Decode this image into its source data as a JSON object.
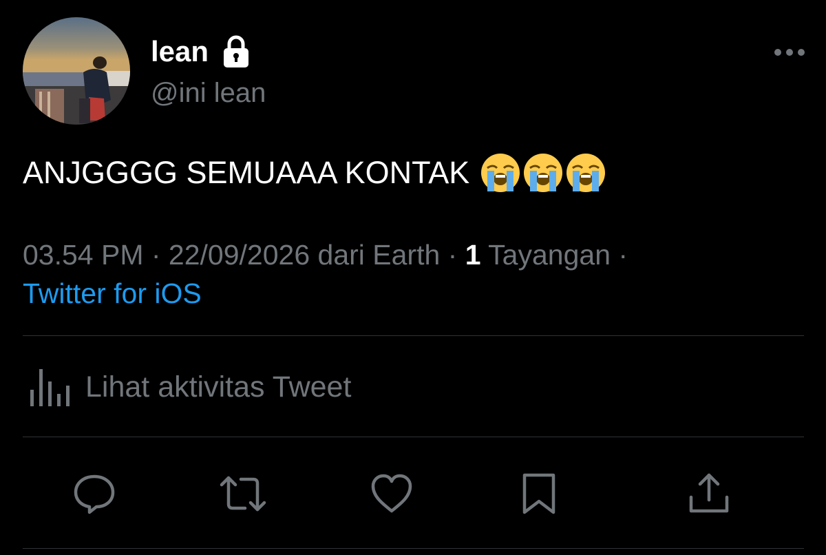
{
  "author": {
    "display_name": "lean",
    "handle": "@ini lean",
    "protected": true
  },
  "tweet": {
    "text": "ANJGGGG SEMUAAA KONTAK",
    "emojis": [
      "loudly-crying-face",
      "loudly-crying-face",
      "loudly-crying-face"
    ]
  },
  "meta": {
    "time_date": "03.54 PM · 22/09/2026 dari Earth · ",
    "views_count": "1",
    "views_label": " Tayangan ·",
    "source": "Twitter for iOS"
  },
  "activity": {
    "label": "Lihat aktivitas Tweet"
  },
  "actions": [
    "reply-icon",
    "retweet-icon",
    "like-icon",
    "bookmark-icon",
    "share-icon"
  ],
  "colors": {
    "background": "#000000",
    "primary_text": "#ffffff",
    "secondary_text": "#71767b",
    "link": "#1d9bf0",
    "divider": "#2f3336"
  }
}
